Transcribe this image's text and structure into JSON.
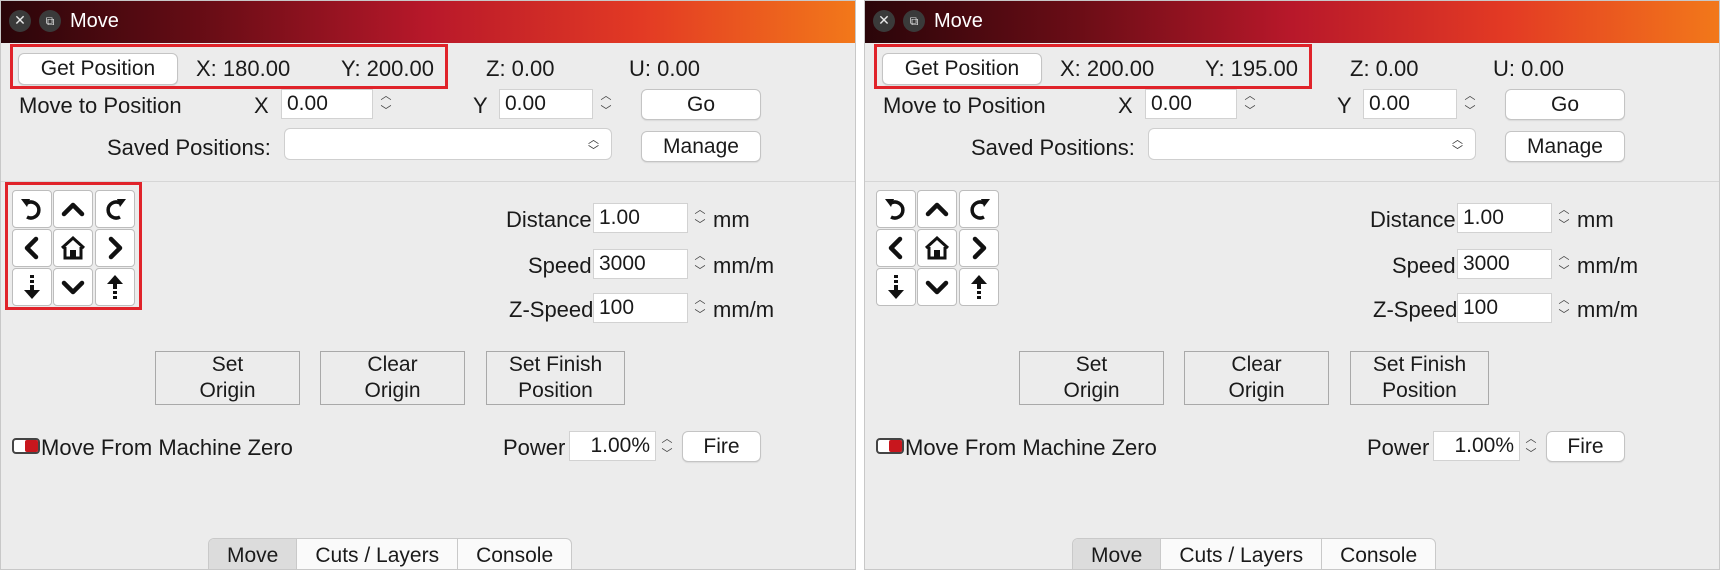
{
  "window": {
    "title": "Move",
    "close_glyph": "✕",
    "restore_glyph": "⧉"
  },
  "common": {
    "get_position_label": "Get Position",
    "z_readout": "Z: 0.00",
    "u_readout": "U: 0.00",
    "move_to_position_label": "Move to Position",
    "x_label": "X",
    "y_label": "Y",
    "x_value": "0.00",
    "y_value": "0.00",
    "go_label": "Go",
    "saved_positions_label": "Saved Positions:",
    "saved_positions_value": "",
    "manage_label": "Manage",
    "distance_label": "Distance",
    "distance_value": "1.00",
    "distance_unit": "mm",
    "speed_label": "Speed",
    "speed_value": "3000",
    "speed_unit": "mm/m",
    "zspeed_label": "Z-Speed",
    "zspeed_value": "100",
    "zspeed_unit": "mm/m",
    "set_origin_line1": "Set",
    "set_origin_line2": "Origin",
    "clear_origin_line1": "Clear",
    "clear_origin_line2": "Origin",
    "set_finish_line1": "Set Finish",
    "set_finish_line2": "Position",
    "move_from_zero_label": "Move From Machine Zero",
    "power_label": "Power",
    "power_value": "1.00%",
    "fire_label": "Fire",
    "tabs": [
      "Move",
      "Cuts / Layers",
      "Console"
    ],
    "active_tab": "Move"
  },
  "left": {
    "x_readout": "X: 180.00",
    "y_readout": "Y: 200.00"
  },
  "right": {
    "x_readout": "X: 200.00",
    "y_readout": "Y: 195.00"
  },
  "icons": {
    "jog": [
      "rotate-ccw-icon",
      "arrow-up-icon",
      "rotate-cw-icon",
      "arrow-left-icon",
      "home-icon",
      "arrow-right-icon",
      "z-down-icon",
      "arrow-down-icon",
      "z-up-icon"
    ]
  },
  "colors": {
    "highlight": "#e0232a",
    "toggle_accent": "#c8161d"
  }
}
